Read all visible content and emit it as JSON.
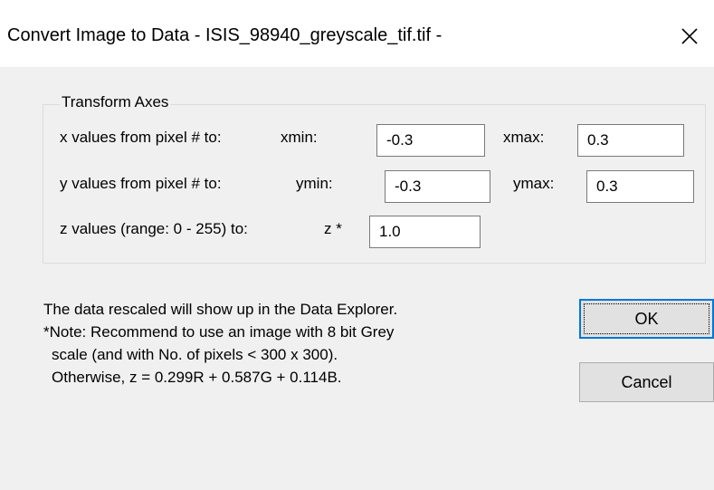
{
  "window": {
    "title": "Convert Image to Data - ISIS_98940_greyscale_tif.tif -",
    "close_glyph": "✕"
  },
  "transform_axes": {
    "legend": "Transform Axes",
    "x_label": "x values from pixel # to:",
    "xmin_label": "xmin:",
    "xmin_value": "-0.3",
    "xmax_label": "xmax:",
    "xmax_value": "0.3",
    "y_label": "y values from pixel # to:",
    "ymin_label": "ymin:",
    "ymin_value": "-0.3",
    "ymax_label": "ymax:",
    "ymax_value": "0.3",
    "z_label": "z values (range: 0 - 255) to:",
    "z_star_label": "z *",
    "z_value": "1.0"
  },
  "notes": {
    "line1": "The data rescaled will show up in the Data Explorer.",
    "line2": "*Note: Recommend to use an image with 8 bit Grey",
    "line3": "scale (and with No. of pixels < 300 x 300).",
    "line4": "Otherwise, z = 0.299R + 0.587G + 0.114B."
  },
  "buttons": {
    "ok": "OK",
    "cancel": "Cancel"
  }
}
